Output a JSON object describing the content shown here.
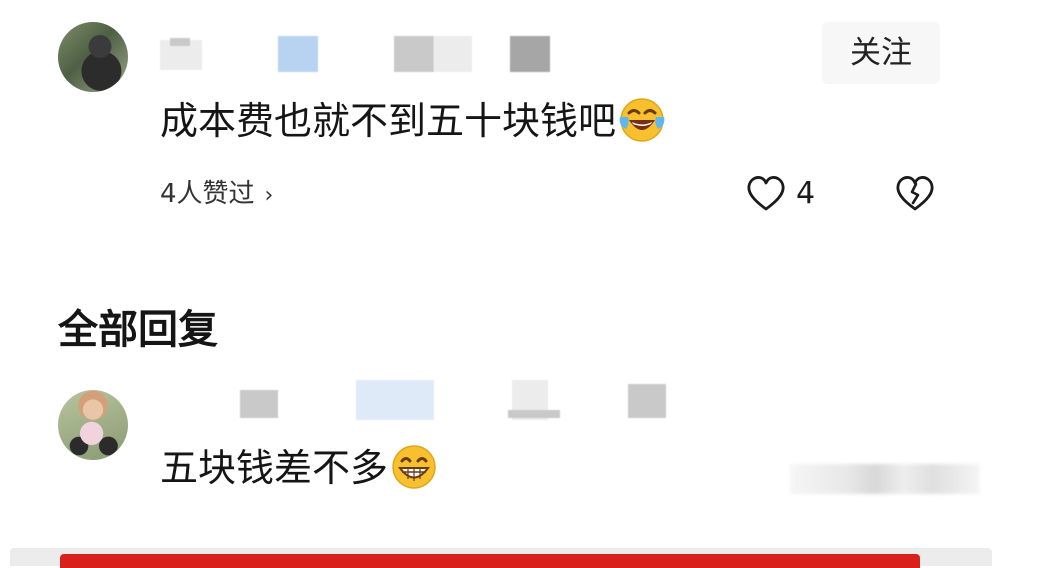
{
  "comment": {
    "follow_label": "关注",
    "text": "成本费也就不到五十块钱吧",
    "emoji": "laughing-tears",
    "liked_by": "4人赞过",
    "like_count": "4"
  },
  "replies_section": {
    "title": "全部回复"
  },
  "reply": {
    "text": "五块钱差不多",
    "emoji": "grinning"
  },
  "colors": {
    "accent_red": "#d9201a",
    "emoji_yellow": "#f6c02e"
  }
}
